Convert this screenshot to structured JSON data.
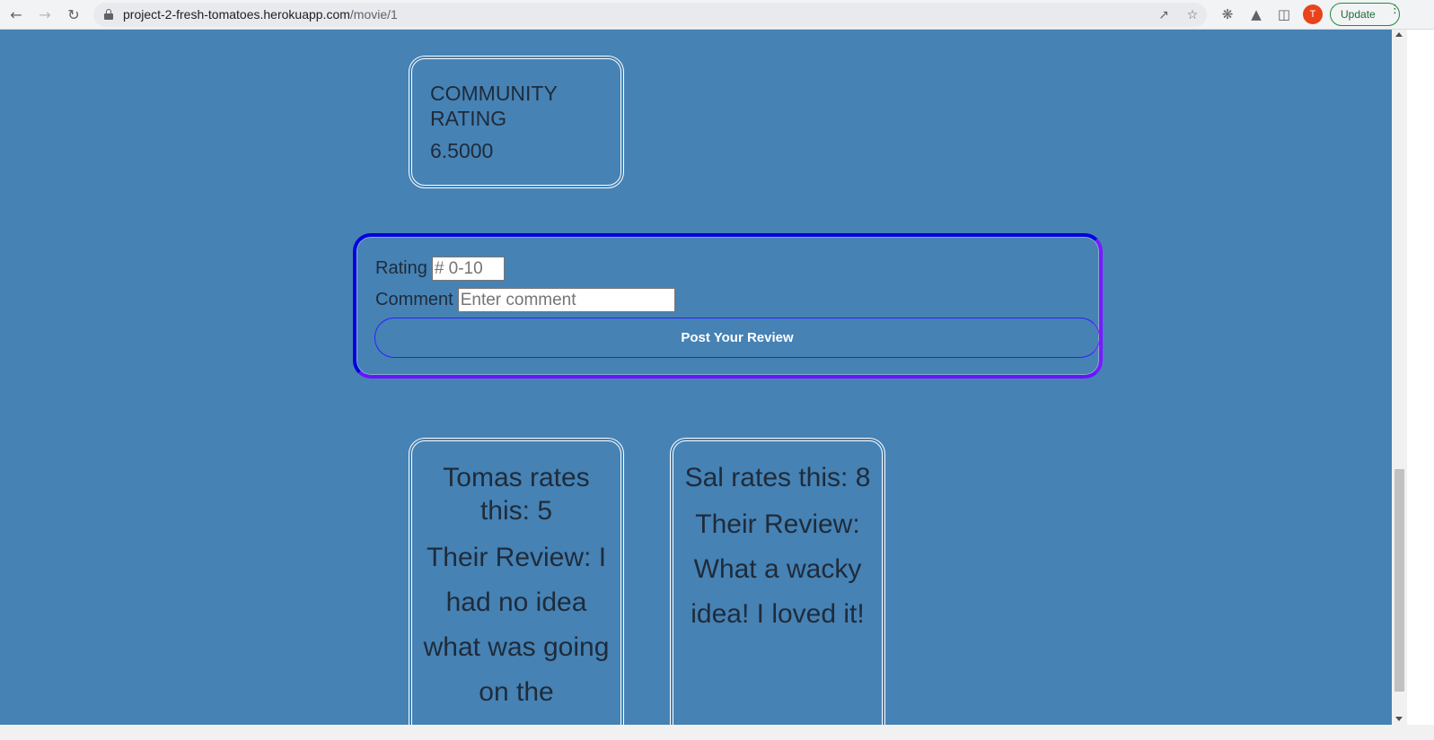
{
  "browser": {
    "url_host": "project-2-fresh-tomatoes.herokuapp.com",
    "url_path": "/movie/1",
    "avatar_letter": "T",
    "update_label": "Update"
  },
  "community": {
    "label": "COMMUNITY RATING",
    "value": "6.5000"
  },
  "review_form": {
    "rating_label": "Rating",
    "rating_placeholder": "# 0-10",
    "comment_label": "Comment",
    "comment_placeholder": "Enter comment",
    "submit_label": "Post Your Review"
  },
  "reviews": [
    {
      "heading": "Tomas rates this: 5",
      "body": "Their Review: I had no idea what was going on the"
    },
    {
      "heading": "Sal rates this: 8",
      "body": "Their Review: What a wacky idea! I loved it!"
    }
  ],
  "colors": {
    "page_background": "#4682b4",
    "form_border_start": "#0000e0",
    "form_border_end": "#7b1aff",
    "card_border": "#ffffff",
    "text": "#1f2b3a"
  }
}
